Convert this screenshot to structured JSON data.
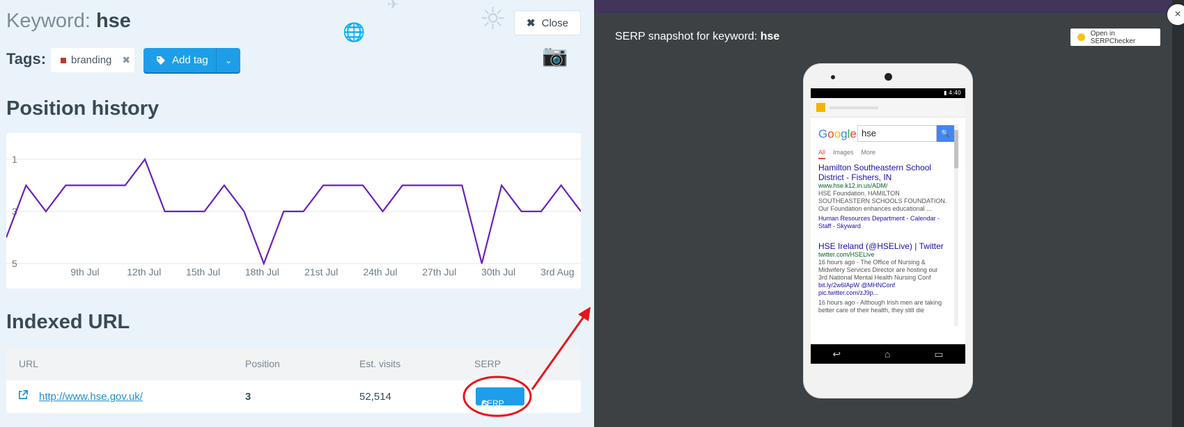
{
  "left": {
    "keyword_prefix": "Keyword:",
    "keyword": "hse",
    "close_label": "Close",
    "tags_label": "Tags:",
    "tags": [
      {
        "label": "branding",
        "color": "#c0392b"
      }
    ],
    "add_tag_label": "Add tag",
    "position_history_title": "Position history",
    "indexed_url_title": "Indexed URL",
    "table": {
      "headers": [
        "URL",
        "Position",
        "Est. visits",
        "SERP"
      ],
      "row": {
        "url": "http://www.hse.gov.uk/",
        "position": "3",
        "visits": "52,514",
        "serp_label": "SERP"
      }
    }
  },
  "chart_data": {
    "type": "line",
    "x_labels": [
      "9th Jul",
      "12th Jul",
      "15th Jul",
      "18th Jul",
      "21st Jul",
      "24th Jul",
      "27th Jul",
      "30th Jul",
      "3rd Aug"
    ],
    "y_ticks": [
      "1",
      "3",
      "5"
    ],
    "ylim": [
      5,
      1
    ],
    "y_inverted": true,
    "values": [
      4,
      2,
      3,
      2,
      2,
      2,
      2,
      1,
      3,
      3,
      3,
      2,
      3,
      5,
      3,
      3,
      2,
      2,
      2,
      3,
      2,
      2,
      2,
      2,
      5,
      2,
      3,
      3,
      2,
      3
    ],
    "color": "#6a1fbf",
    "grid": true
  },
  "modal": {
    "title_prefix": "SERP snapshot for keyword:",
    "keyword": "hse",
    "open_label": "Open in SERPChecker",
    "close_symbol": "×"
  },
  "phone": {
    "status_time": "4:40",
    "search_query": "hse",
    "google_letters": [
      "G",
      "o",
      "o",
      "g",
      "l",
      "e"
    ],
    "tabs": [
      "All",
      "Images",
      "More"
    ],
    "results": [
      {
        "title": "Hamilton Southeastern School District - Fishers, IN",
        "url": "www.hse.k12.in.us/ADM/",
        "snippet": "HSE Foundation. HAMILTON SOUTHEASTERN SCHOOLS FOUNDATION. Our Foundation enhances educational ...",
        "sublinks": "Human Resources Department - Calendar - Staff - Skyward"
      },
      {
        "title": "HSE Ireland (@HSELive) | Twitter",
        "url": "twitter.com/HSELive",
        "snippet": "16 hours ago - The Office of Nursing & Midwifery Services Director are hosting our 3rd National Mental Health Nursing Conf",
        "links": "bit.ly/2w6lApW @MHNConf pic.twitter.com/zJ9p...",
        "snippet2": "16 hours ago - Although Irish men are taking better care of their health, they still die"
      }
    ]
  }
}
